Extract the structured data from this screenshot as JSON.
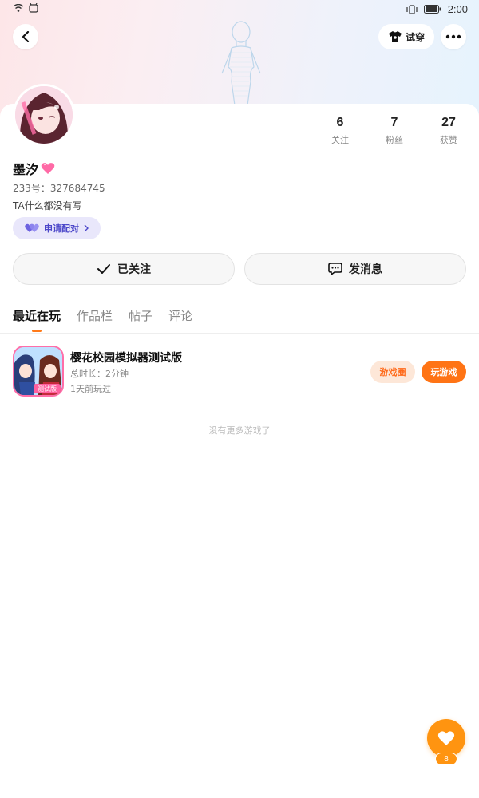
{
  "status_bar": {
    "time": "2:00"
  },
  "header": {
    "tryon_label": "试穿"
  },
  "profile": {
    "name": "墨汐",
    "uid": "233号：327684745",
    "bio": "TA什么都没有写",
    "match_label": "申请配对",
    "stats": [
      {
        "value": "6",
        "label": "关注"
      },
      {
        "value": "7",
        "label": "粉丝"
      },
      {
        "value": "27",
        "label": "获赞"
      }
    ]
  },
  "actions": {
    "follow_label": "已关注",
    "message_label": "发消息"
  },
  "tabs": [
    {
      "label": "最近在玩",
      "active": true
    },
    {
      "label": "作品栏",
      "active": false
    },
    {
      "label": "帖子",
      "active": false
    },
    {
      "label": "评论",
      "active": false
    }
  ],
  "games": [
    {
      "title": "樱花校园模拟器测试版",
      "playtime": "总时长：2分钟",
      "last_played": "1天前玩过",
      "icon_badge": "测试版",
      "circle_label": "游戏圈",
      "play_label": "玩游戏"
    }
  ],
  "no_more_text": "没有更多游戏了",
  "fab": {
    "count": "8"
  },
  "colors": {
    "accent": "#ff7415",
    "fab": "#ff9410",
    "match_bg": "#e9e7fb",
    "match_text": "#4b46c9"
  }
}
